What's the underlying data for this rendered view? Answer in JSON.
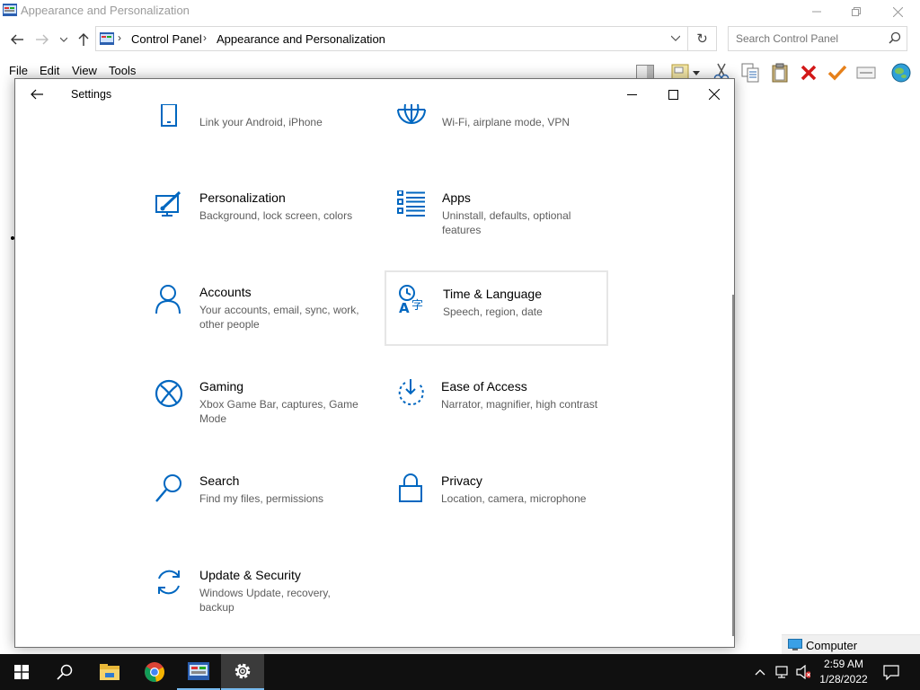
{
  "explorer": {
    "title": "Appearance and Personalization",
    "breadcrumb": [
      "Control Panel",
      "Appearance and Personalization"
    ],
    "search_placeholder": "Search Control Panel",
    "menu": [
      "File",
      "Edit",
      "View",
      "Tools"
    ],
    "status_location": "Computer"
  },
  "settings": {
    "title": "Settings",
    "tiles": [
      {
        "name": "",
        "desc": "Link your Android, iPhone",
        "icon": "phone-icon"
      },
      {
        "name": "",
        "desc": "Wi-Fi, airplane mode, VPN",
        "icon": "globe-network-icon"
      },
      {
        "name": "Personalization",
        "desc": "Background, lock screen, colors",
        "icon": "personalization-icon"
      },
      {
        "name": "Apps",
        "desc": "Uninstall, defaults, optional features",
        "icon": "apps-list-icon"
      },
      {
        "name": "Accounts",
        "desc": "Your accounts, email, sync, work, other people",
        "icon": "person-icon"
      },
      {
        "name": "Time & Language",
        "desc": "Speech, region, date",
        "icon": "time-language-icon"
      },
      {
        "name": "Gaming",
        "desc": "Xbox Game Bar, captures, Game Mode",
        "icon": "xbox-icon"
      },
      {
        "name": "Ease of Access",
        "desc": "Narrator, magnifier, high contrast",
        "icon": "ease-of-access-icon"
      },
      {
        "name": "Search",
        "desc": "Find my files, permissions",
        "icon": "search-icon"
      },
      {
        "name": "Privacy",
        "desc": "Location, camera, microphone",
        "icon": "lock-icon"
      },
      {
        "name": "Update & Security",
        "desc": "Windows Update, recovery, backup",
        "icon": "update-sync-icon"
      }
    ],
    "accent_color": "#0067c0"
  },
  "taskbar": {
    "time": "2:59 AM",
    "date": "1/28/2022"
  }
}
